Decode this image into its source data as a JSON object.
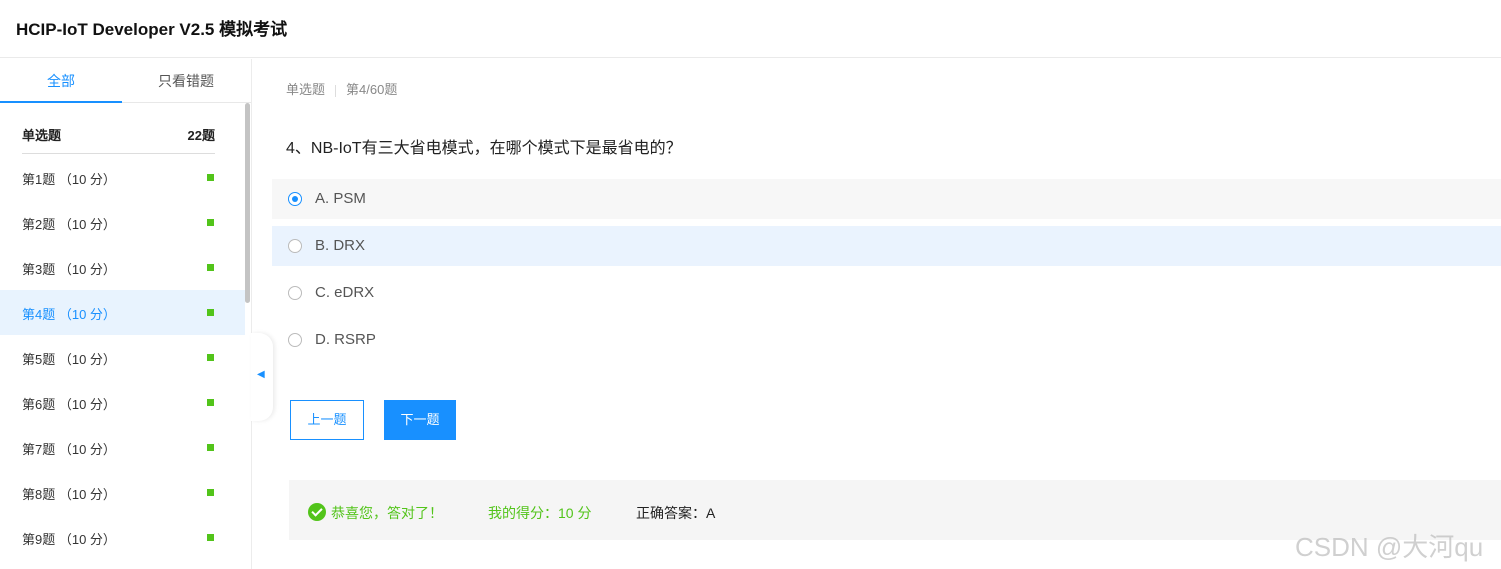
{
  "header": {
    "title": "HCIP-IoT Developer V2.5 模拟考试"
  },
  "sidebar": {
    "tabs": [
      {
        "label": "全部"
      },
      {
        "label": "只看错题"
      }
    ],
    "section": {
      "name": "单选题",
      "count": "22题"
    },
    "questions": [
      {
        "label": "第1题 （10 分）",
        "status_color": "#52c41a"
      },
      {
        "label": "第2题 （10 分）",
        "status_color": "#52c41a"
      },
      {
        "label": "第3题 （10 分）",
        "status_color": "#52c41a"
      },
      {
        "label": "第4题 （10 分）",
        "status_color": "#52c41a"
      },
      {
        "label": "第5题 （10 分）",
        "status_color": "#52c41a"
      },
      {
        "label": "第6题 （10 分）",
        "status_color": "#52c41a"
      },
      {
        "label": "第7题 （10 分）",
        "status_color": "#52c41a"
      },
      {
        "label": "第8题 （10 分）",
        "status_color": "#52c41a"
      },
      {
        "label": "第9题 （10 分）",
        "status_color": "#52c41a"
      }
    ],
    "active_index": 3,
    "collapse_icon": "triangle-left-icon"
  },
  "main": {
    "meta": {
      "type": "单选题",
      "progress": "第4/60题"
    },
    "question": "4、NB-IoT有三大省电模式，在哪个模式下是最省电的？",
    "options": [
      {
        "label": "A. PSM"
      },
      {
        "label": "B. DRX"
      },
      {
        "label": "C. eDRX"
      },
      {
        "label": "D. RSRP"
      }
    ],
    "selected_index": 0,
    "buttons": {
      "prev": "上一题",
      "next": "下一题"
    },
    "result": {
      "message": "恭喜您，答对了！",
      "score": "我的得分：10 分",
      "answer": "正确答案：A",
      "icon": "check-circle-icon"
    }
  },
  "watermark": "CSDN @大河qu",
  "colors": {
    "accent": "#1890ff",
    "success": "#52c41a"
  }
}
